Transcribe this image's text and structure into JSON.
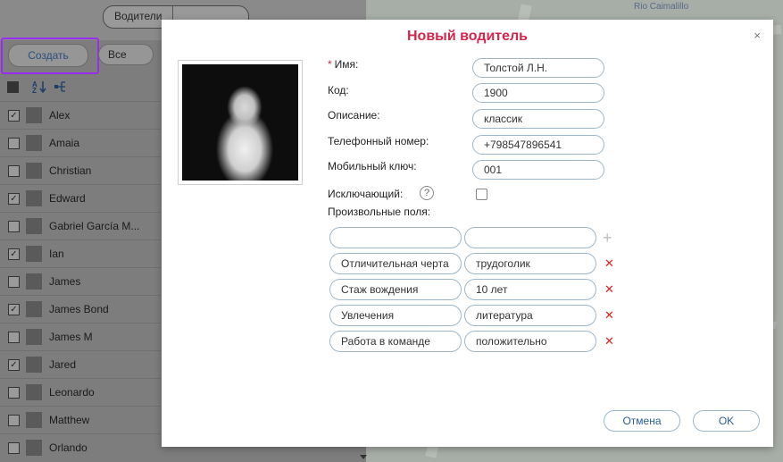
{
  "map": {
    "label_top": "Rio Caimalillo"
  },
  "left_panel": {
    "segment_tabs": [
      "Водители",
      ""
    ],
    "create_label": "Создать",
    "all_label": "Все",
    "drivers": [
      {
        "name": "Alex",
        "checked": true
      },
      {
        "name": "Amaia",
        "checked": false
      },
      {
        "name": "Christian",
        "checked": false
      },
      {
        "name": "Edward",
        "checked": true
      },
      {
        "name": "Gabriel García M...",
        "checked": false
      },
      {
        "name": "Ian",
        "checked": true
      },
      {
        "name": "James",
        "checked": false
      },
      {
        "name": "James Bond",
        "checked": true
      },
      {
        "name": "James M",
        "checked": false
      },
      {
        "name": "Jared",
        "checked": true
      },
      {
        "name": "Leonardo",
        "checked": false
      },
      {
        "name": "Matthew",
        "checked": false
      },
      {
        "name": "Orlando",
        "checked": false
      }
    ]
  },
  "dialog": {
    "title": "Новый водитель",
    "close": "×",
    "fields": {
      "name_label": "Имя:",
      "name_value": "Толстой Л.Н.",
      "code_label": "Код:",
      "code_value": "1900",
      "desc_label": "Описание:",
      "desc_value": "классик",
      "phone_label": "Телефонный номер:",
      "phone_value": "+798547896541",
      "mobile_key_label": "Мобильный ключ:",
      "mobile_key_value": "001",
      "exclusive_label": "Исключающий:",
      "custom_fields_label": "Произвольные поля:"
    },
    "custom_fields": [
      {
        "key": "Отличительная черта",
        "value": "трудоголик"
      },
      {
        "key": "Стаж вождения",
        "value": "10 лет"
      },
      {
        "key": "Увлечения",
        "value": "литература"
      },
      {
        "key": "Работа в команде",
        "value": "положительно"
      }
    ],
    "cancel_label": "Отмена",
    "ok_label": "OK"
  }
}
